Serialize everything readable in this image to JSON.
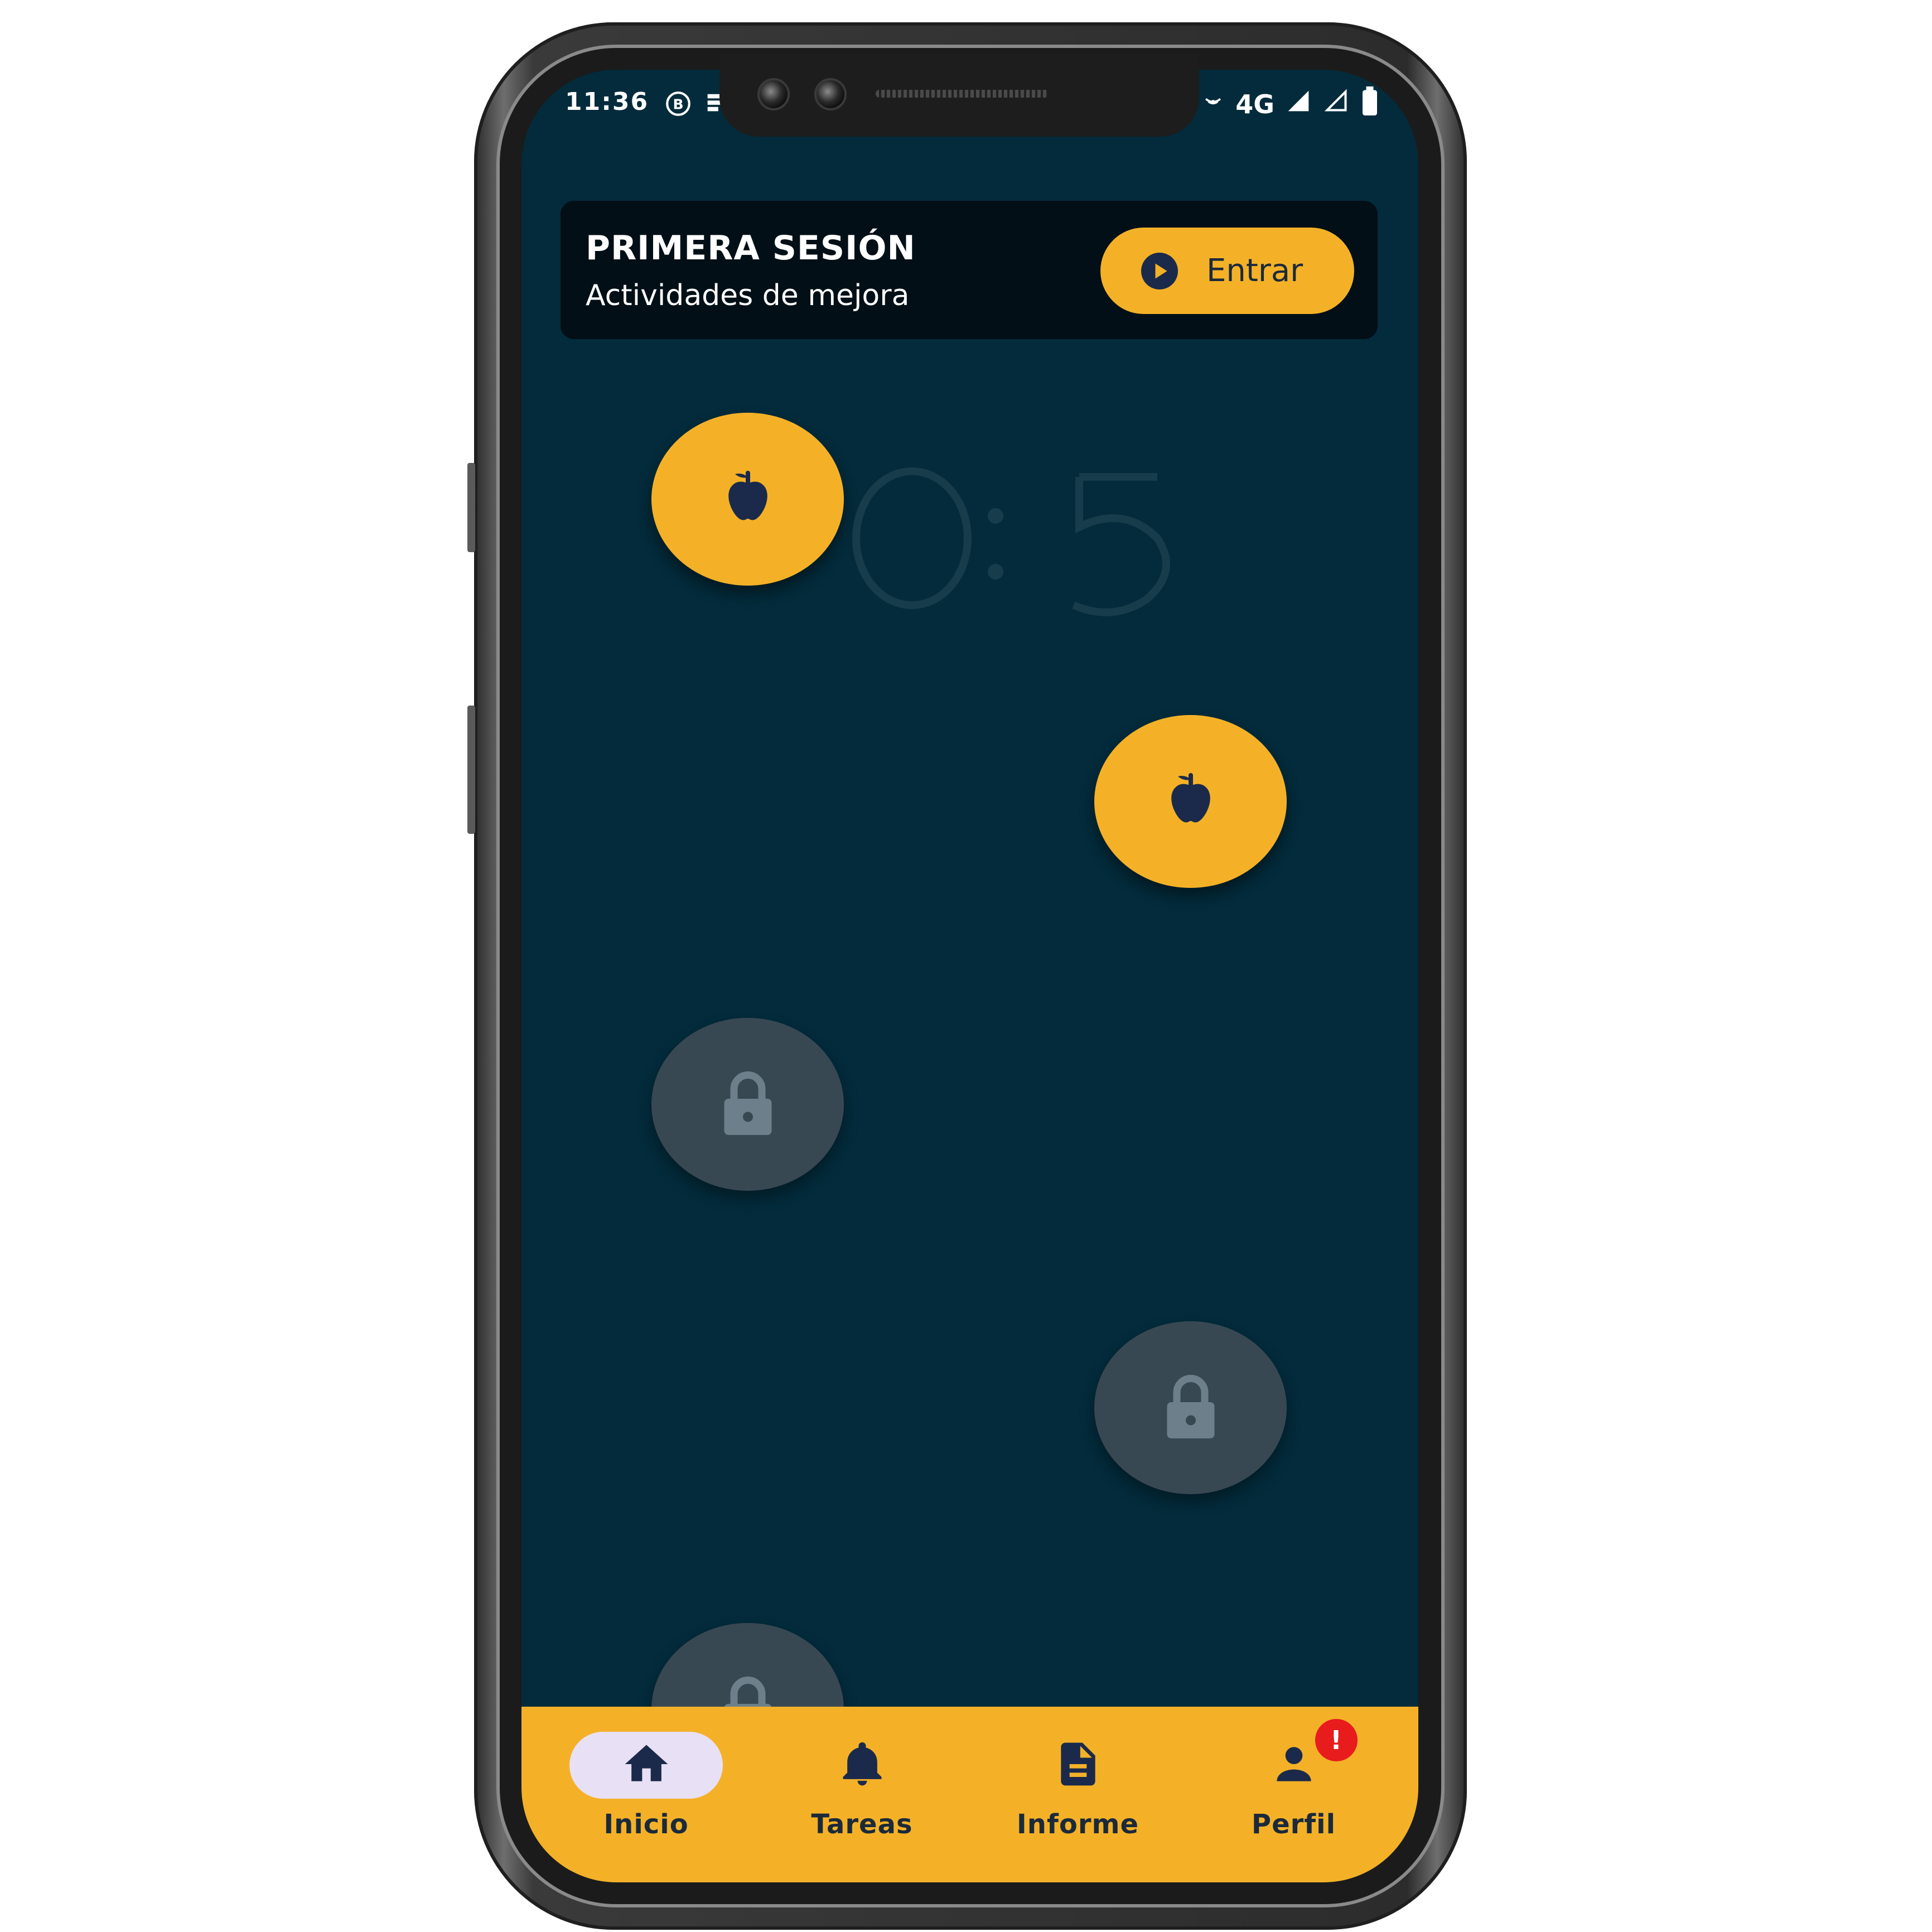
{
  "status_bar": {
    "time": "11:36",
    "network": "4G",
    "left_icons": [
      "b-circle-icon",
      "sd-storage-icon"
    ],
    "right_icons": [
      "hotspot-icon",
      "signal-icon",
      "signal-outline-icon",
      "battery-icon"
    ]
  },
  "session": {
    "title": "PRIMERA SESIÓN",
    "subtitle": "Actividades de mejora",
    "enter_button": "Entrar",
    "enter_icon": "play-circle-icon"
  },
  "levels": [
    {
      "state": "unlocked",
      "icon": "apple-icon"
    },
    {
      "state": "unlocked",
      "icon": "apple-icon"
    },
    {
      "state": "locked",
      "icon": "lock-icon"
    },
    {
      "state": "locked",
      "icon": "lock-icon"
    },
    {
      "state": "locked",
      "icon": "lock-icon"
    }
  ],
  "bottom_nav": {
    "items": [
      {
        "label": "Inicio",
        "icon": "home-icon",
        "active": true
      },
      {
        "label": "Tareas",
        "icon": "bell-icon",
        "active": false
      },
      {
        "label": "Informe",
        "icon": "document-icon",
        "active": false
      },
      {
        "label": "Perfil",
        "icon": "person-icon",
        "active": false,
        "badge": "!"
      }
    ]
  },
  "colors": {
    "background": "#032b3b",
    "card": "#020f16",
    "accent": "#f4b128",
    "locked": "#384853",
    "icon_dark": "#1b2a4a",
    "badge": "#e81c1c"
  }
}
